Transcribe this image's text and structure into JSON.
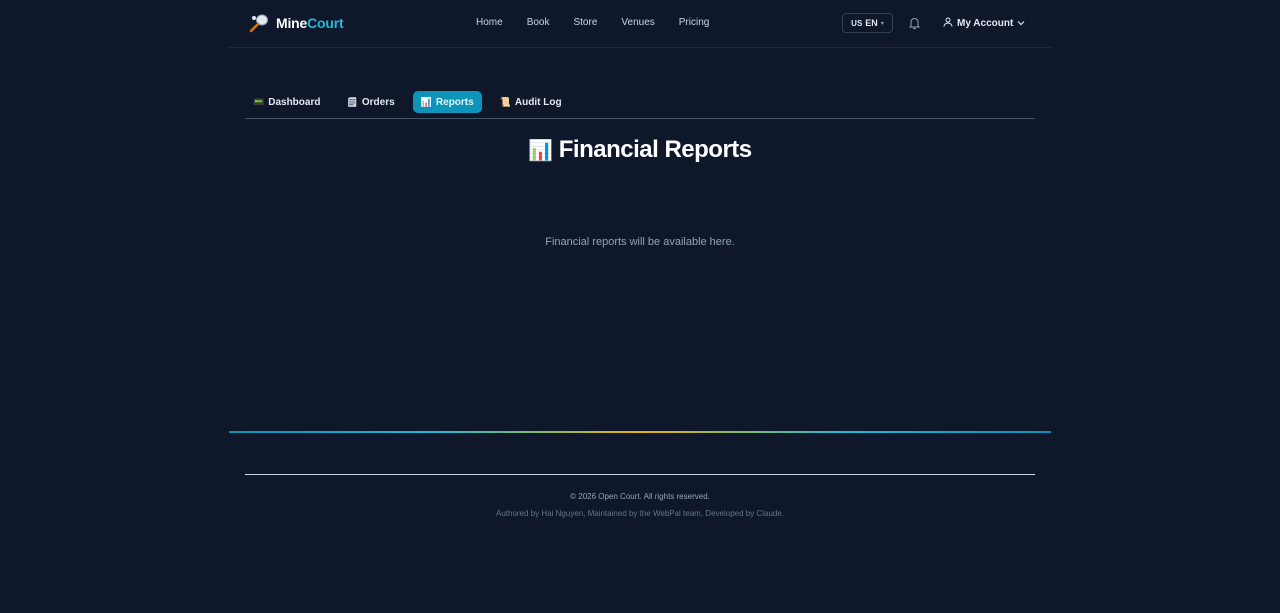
{
  "brand": {
    "name_part1": "Mine",
    "name_part2": "Court"
  },
  "nav": [
    "Home",
    "Book",
    "Store",
    "Venues",
    "Pricing"
  ],
  "lang": {
    "flag": "US",
    "code": "EN"
  },
  "account": {
    "label": "My Account"
  },
  "tabs": [
    {
      "icon": "📟",
      "label": "Dashboard"
    },
    {
      "icon": "🗒",
      "label": "Orders"
    },
    {
      "icon": "📊",
      "label": "Reports"
    },
    {
      "icon": "📜",
      "label": "Audit Log"
    }
  ],
  "page": {
    "title_icon": "📊",
    "title": "Financial Reports",
    "notice": "Financial reports will be available here."
  },
  "footer": {
    "copyright": "© 2026 Open Court. All rights reserved.",
    "credits": "Authored by Hai Nguyen, Maintained by the WebPal team, Developed by Claude."
  },
  "colors": {
    "background": "#0f172a",
    "accent": "#0e94b8",
    "brand_accent": "#22b8d8"
  }
}
